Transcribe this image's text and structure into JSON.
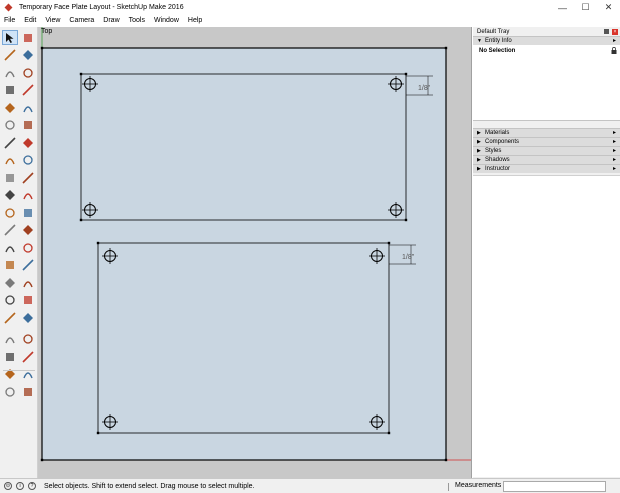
{
  "window": {
    "title": "Temporary Face Plate Layout - SketchUp Make 2016",
    "minimize": "—",
    "maximize": "☐",
    "close": "✕"
  },
  "menu": [
    "File",
    "Edit",
    "View",
    "Camera",
    "Draw",
    "Tools",
    "Window",
    "Help"
  ],
  "viewport": {
    "scene_label": "Top",
    "dimension_labels": [
      "1/8\"",
      "1/8\""
    ]
  },
  "tray": {
    "title": "Default Tray",
    "entity_info": {
      "title": "Entity Info",
      "selection": "No Selection"
    },
    "panels": [
      "Materials",
      "Components",
      "Styles",
      "Shadows",
      "Instructor"
    ]
  },
  "status": {
    "message": "Select objects. Shift to extend select. Drag mouse to select multiple.",
    "measurements_label": "Measurements",
    "measurements_value": ""
  },
  "tools": [
    "select-icon",
    "eraser-icon",
    "paint-bucket-icon",
    "eraser-alt-icon",
    "line-icon",
    "freehand-icon",
    "rectangle-icon",
    "rotated-rectangle-icon",
    "circle-icon",
    "polygon-icon",
    "arc-icon",
    "pie-icon",
    "arc-2pt-icon",
    "arc-3pt-icon",
    "move-icon",
    "push-pull-icon",
    "rotate-icon",
    "follow-me-icon",
    "scale-icon",
    "offset-icon",
    "tape-measure-icon",
    "dimension-icon",
    "protractor-icon",
    "text-icon",
    "axes-icon",
    "3d-text-icon",
    "orbit-icon",
    "pan-icon",
    "zoom-icon",
    "zoom-window-icon",
    "zoom-extents-icon",
    "previous-view-icon",
    "position-camera-icon",
    "look-around-icon",
    "walk-icon",
    "section-plane-icon",
    "warehouse-icon",
    "extension-icon",
    "home-icon",
    "model-info-icon",
    "house-icon",
    "layers-icon"
  ],
  "colors": {
    "plate_fill": "#c9d6e1",
    "viewport_bg": "#c8c8c8",
    "outline": "#000000",
    "axis_red": "#d42b2b",
    "axis_green": "#3a9a3a"
  }
}
